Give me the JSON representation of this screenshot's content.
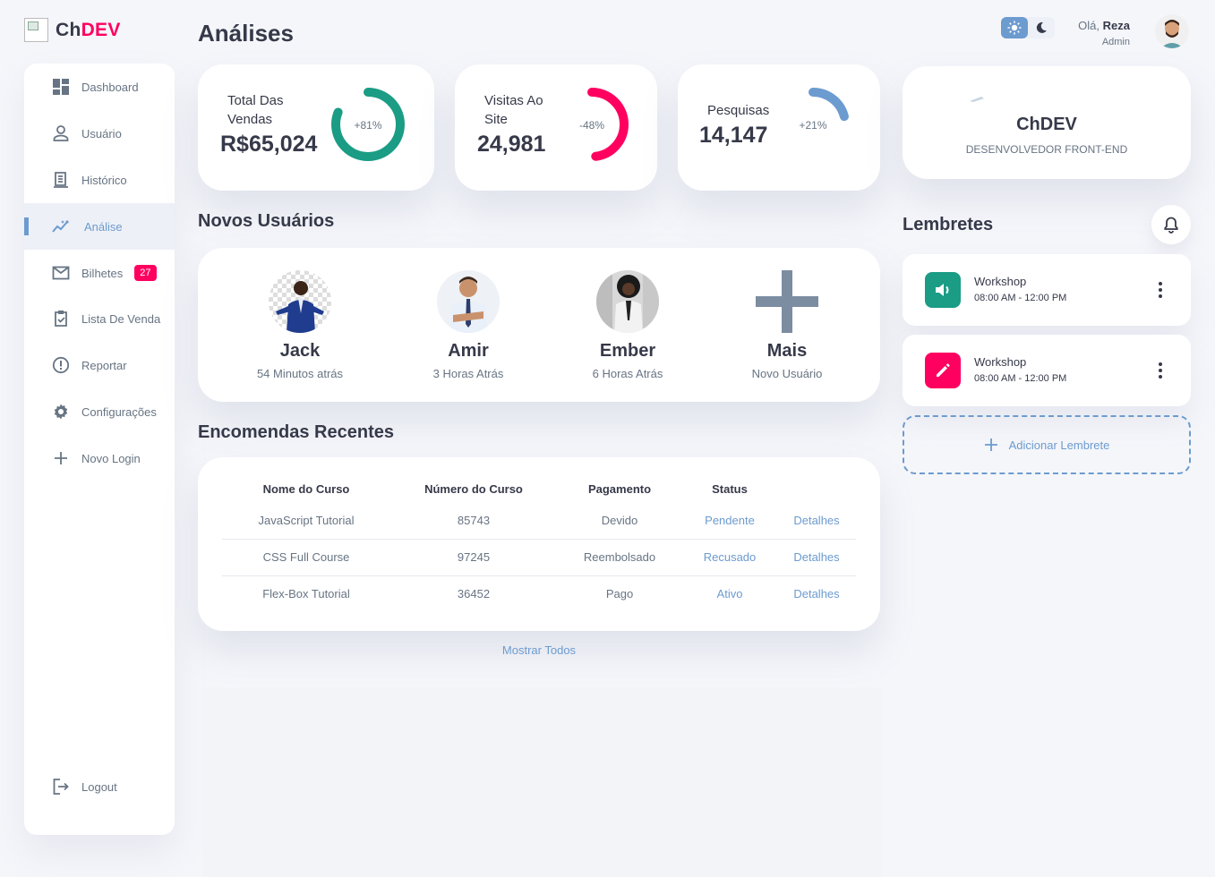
{
  "brand": {
    "prefix": "Ch",
    "accent": "DEV",
    "accent_color": "#ff0060"
  },
  "sidebar": {
    "items": [
      {
        "label": "Dashboard",
        "icon": "dashboard-icon"
      },
      {
        "label": "Usuário",
        "icon": "person-icon"
      },
      {
        "label": "Histórico",
        "icon": "receipt-icon"
      },
      {
        "label": "Análise",
        "icon": "insights-icon",
        "active": true
      },
      {
        "label": "Bilhetes",
        "icon": "mail-icon",
        "badge": "27"
      },
      {
        "label": "Lista De Venda",
        "icon": "clipboard-check-icon"
      },
      {
        "label": "Reportar",
        "icon": "report-icon"
      },
      {
        "label": "Configurações",
        "icon": "gear-icon"
      },
      {
        "label": "Novo Login",
        "icon": "plus-icon"
      }
    ],
    "logout": "Logout"
  },
  "page_title": "Análises",
  "stats": [
    {
      "label_line1": "Total Das",
      "label_line2": "Vendas",
      "value": "R$65,024",
      "percent": "+81%",
      "color": "#1b9c85"
    },
    {
      "label_line1": "Visitas Ao",
      "label_line2": "Site",
      "value": "24,981",
      "percent": "-48%",
      "color": "#ff0060"
    },
    {
      "label_line1": "Pesquisas",
      "label_line2": "",
      "value": "14,147",
      "percent": "+21%",
      "color": "#6c9bcf"
    }
  ],
  "new_users": {
    "title": "Novos Usuários",
    "users": [
      {
        "name": "Jack",
        "time": "54 Minutos atrás"
      },
      {
        "name": "Amir",
        "time": "3 Horas Atrás"
      },
      {
        "name": "Ember",
        "time": "6 Horas Atrás"
      },
      {
        "name": "Mais",
        "time": "Novo Usuário"
      }
    ]
  },
  "orders": {
    "title": "Encomendas Recentes",
    "headers": [
      "Nome do Curso",
      "Número do Curso",
      "Pagamento",
      "Status",
      ""
    ],
    "rows": [
      [
        "JavaScript Tutorial",
        "85743",
        "Devido",
        "Pendente",
        "Detalhes"
      ],
      [
        "CSS Full Course",
        "97245",
        "Reembolsado",
        "Recusado",
        "Detalhes"
      ],
      [
        "Flex-Box Tutorial",
        "36452",
        "Pago",
        "Ativo",
        "Detalhes"
      ]
    ],
    "show_all": "Mostrar Todos"
  },
  "header": {
    "greeting": "Olá, ",
    "user": "Reza",
    "role": "Admin"
  },
  "profile_card": {
    "name": "ChDEV",
    "subtitle": "DESENVOLVEDOR FRONT-END"
  },
  "reminders": {
    "title": "Lembretes",
    "items": [
      {
        "title": "Workshop",
        "time": "08:00 AM - 12:00 PM",
        "icon": "volume-icon",
        "color": "#1b9c85"
      },
      {
        "title": "Workshop",
        "time": "08:00 AM - 12:00 PM",
        "icon": "edit-icon",
        "color": "#ff0060"
      }
    ],
    "add_label": "Adicionar Lembrete"
  }
}
